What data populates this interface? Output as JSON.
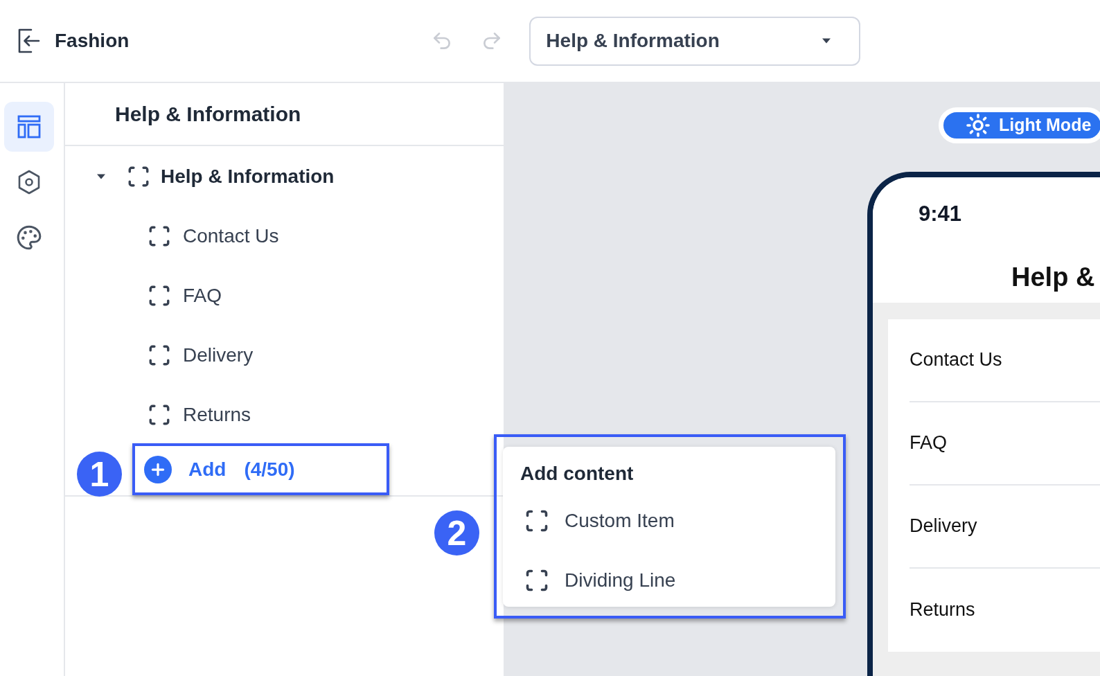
{
  "header": {
    "title": "Fashion",
    "page_select": {
      "value": "Help & Information"
    }
  },
  "rail": {
    "items": [
      {
        "kind": "layout",
        "selected": true
      },
      {
        "kind": "settings",
        "selected": false
      },
      {
        "kind": "theme",
        "selected": false
      }
    ]
  },
  "panel": {
    "title": "Help & Information",
    "tree": [
      {
        "label": "Help & Information",
        "expanded": true,
        "children": [
          {
            "label": "Contact Us"
          },
          {
            "label": "FAQ"
          },
          {
            "label": "Delivery"
          },
          {
            "label": "Returns"
          }
        ]
      }
    ],
    "add_button": {
      "label": "Add",
      "count": "(4/50)"
    }
  },
  "add_menu": {
    "title": "Add content",
    "items": [
      {
        "label": "Custom Item"
      },
      {
        "label": "Dividing Line"
      }
    ]
  },
  "preview": {
    "mode_button": {
      "label": "Light Mode"
    },
    "phone": {
      "time": "9:41",
      "title": "Help &",
      "items": [
        "Contact Us",
        "FAQ",
        "Delivery",
        "Returns"
      ]
    }
  },
  "annotations": [
    {
      "number": "1"
    },
    {
      "number": "2"
    }
  ]
}
